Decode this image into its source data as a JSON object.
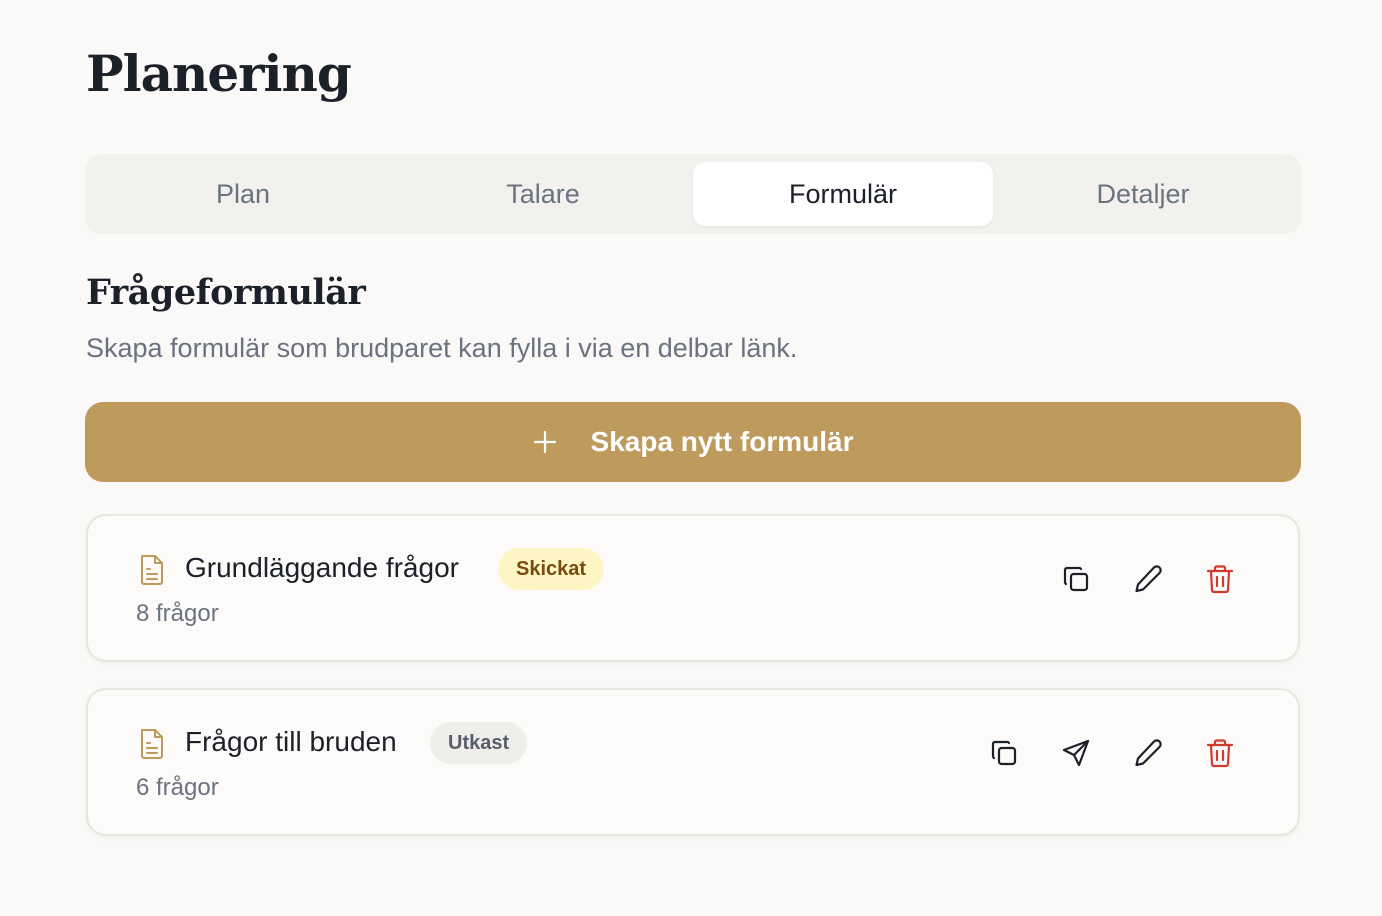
{
  "page": {
    "title": "Planering"
  },
  "tabs": [
    {
      "label": "Plan",
      "active": false
    },
    {
      "label": "Talare",
      "active": false
    },
    {
      "label": "Formulär",
      "active": true
    },
    {
      "label": "Detaljer",
      "active": false
    }
  ],
  "section": {
    "title": "Frågeformulär",
    "description": "Skapa formulär som brudparet kan fylla i via en delbar länk."
  },
  "create_button": {
    "label": "Skapa nytt formulär",
    "icon": "plus-icon"
  },
  "forms": [
    {
      "title": "Grundläggande frågor",
      "status": "Skickat",
      "count": "8 frågor",
      "actions": [
        "copy-icon",
        "pencil-icon",
        "trash-icon"
      ]
    },
    {
      "title": "Frågor till bruden",
      "status": "Utkast",
      "count": "6 frågor",
      "actions": [
        "copy-icon",
        "send-icon",
        "pencil-icon",
        "trash-icon"
      ]
    }
  ],
  "colors": {
    "accent": "#be9b5d",
    "danger": "#d13a2f",
    "sent_badge_bg": "#fdf6c4",
    "sent_badge_text": "#7a4a10",
    "draft_badge_bg": "#efeeeb",
    "muted_text": "#6b7280"
  }
}
